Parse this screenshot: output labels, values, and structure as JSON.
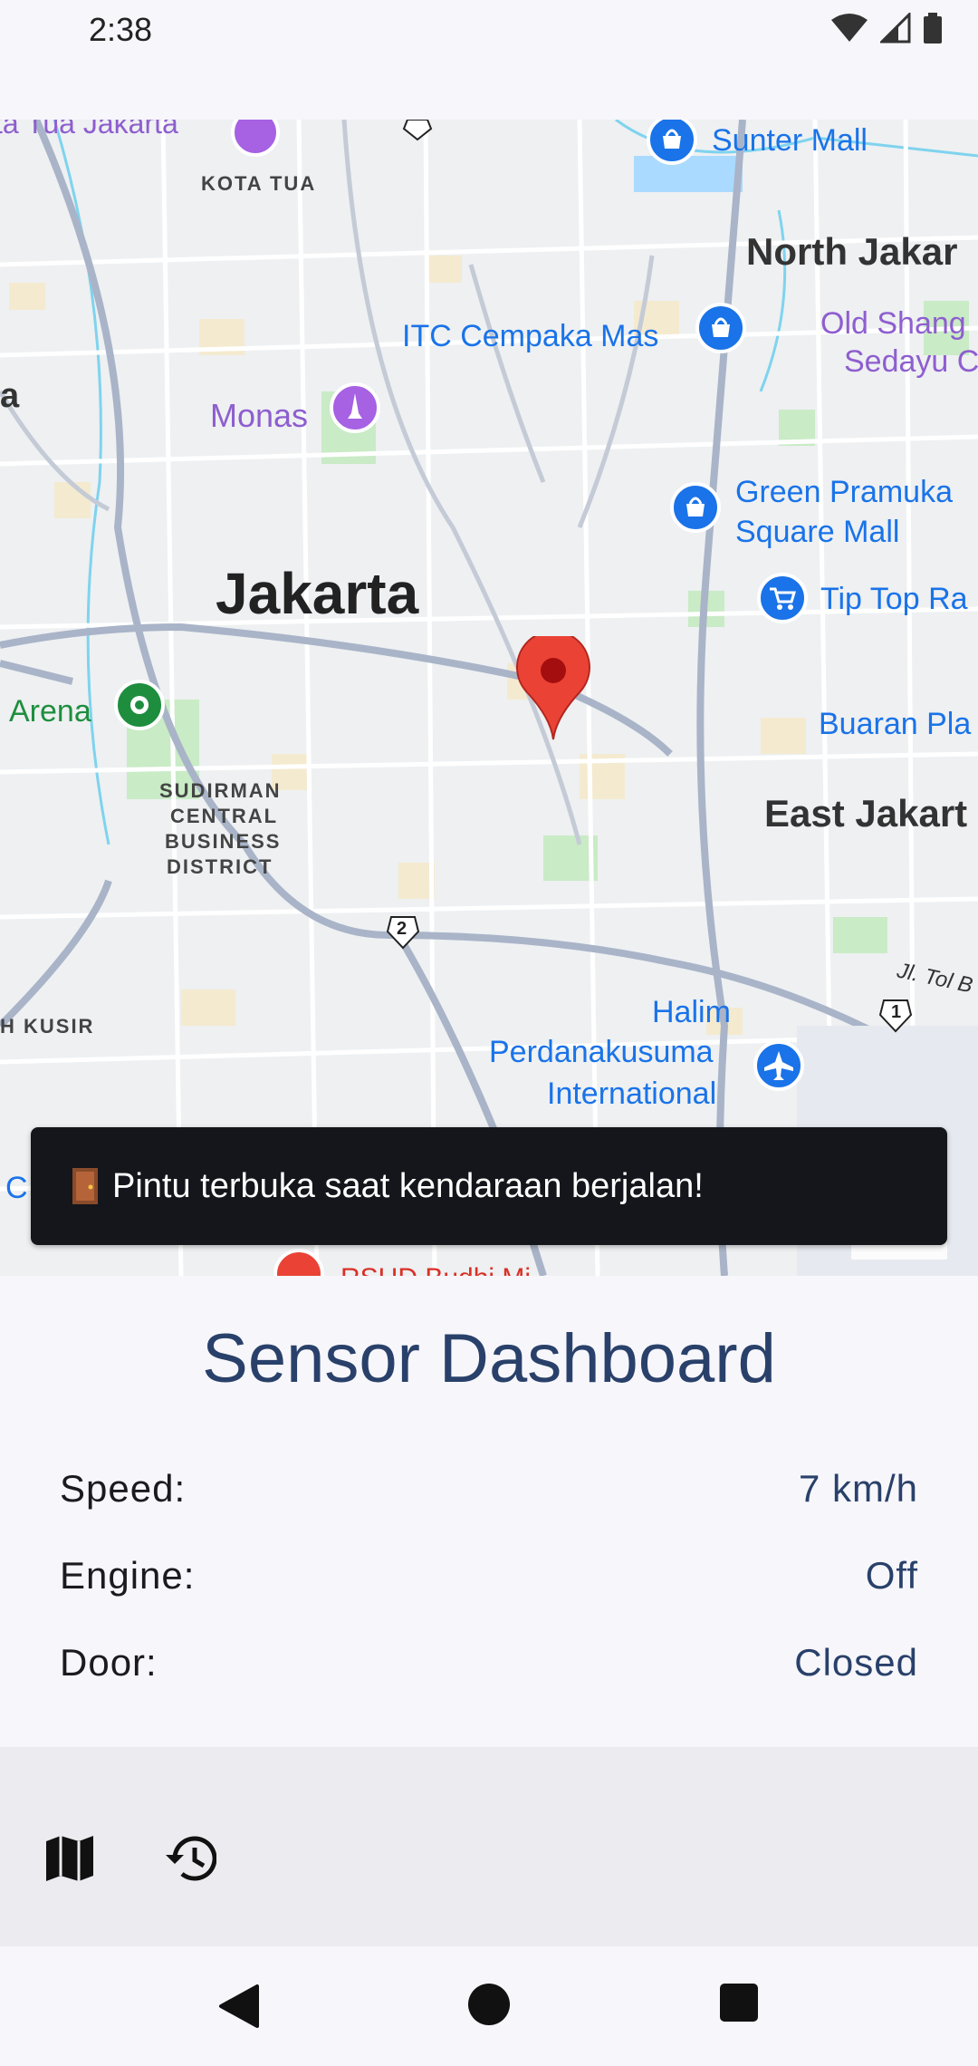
{
  "status_bar": {
    "time": "2:38"
  },
  "map": {
    "labels": {
      "kota_tua_partial": "ta Tua Jakarta",
      "kota_tua": "KOTA TUA",
      "sunter_mall": "Sunter Mall",
      "north_jakarta": "North Jakar",
      "itc_cempaka": "ITC Cempaka Mas",
      "old_shanghai_1": "Old Shang",
      "old_shanghai_2": "Sedayu C",
      "left_a": "a",
      "monas": "Monas",
      "green_pramuka_1": "Green Pramuka",
      "green_pramuka_2": "Square Mall",
      "jakarta": "Jakarta",
      "tip_top": "Tip Top Ra",
      "arena": "Arena",
      "buaran": "Buaran Pla",
      "sudirman_1": "SUDIRMAN",
      "sudirman_2": "CENTRAL",
      "sudirman_3": "BUSINESS",
      "sudirman_4": "DISTRICT",
      "east_jakarta": "East Jakart",
      "route_2": "2",
      "jl_tol": "Jl. Tol B",
      "route_1": "1",
      "kusir": "H KUSIR",
      "halim_1": "Halim",
      "halim_2": "Perdanakusuma",
      "halim_3": "International",
      "rsud": "RSUD Budhi Mi",
      "google_partial": "C"
    },
    "zoom_in_label": "+"
  },
  "snackbar": {
    "message": "Pintu terbuka saat kendaraan berjalan!"
  },
  "dashboard": {
    "title": "Sensor Dashboard",
    "rows": [
      {
        "label": "Speed:",
        "value": "7 km/h"
      },
      {
        "label": "Engine:",
        "value": "Off"
      },
      {
        "label": "Door:",
        "value": "Closed"
      }
    ]
  },
  "colors": {
    "accent": "#29416a",
    "poi_purple": "#a761e3",
    "poi_blue": "#1a73e8",
    "marker_red": "#ea4335",
    "park_green": "#c9ebc6"
  }
}
